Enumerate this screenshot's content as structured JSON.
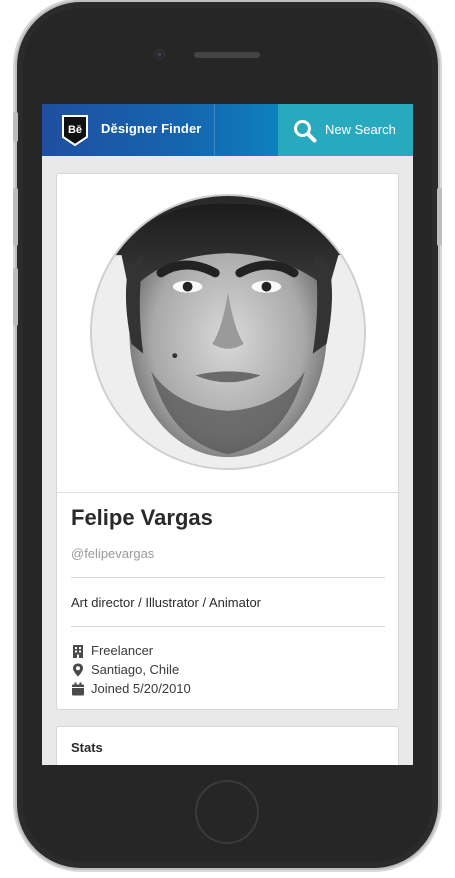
{
  "app": {
    "title": "Dĕsigner Finder",
    "logo_text": "Bē",
    "search_button_label": "New Search"
  },
  "profile": {
    "name": "Felipe Vargas",
    "handle": "@felipevargas",
    "role": "Art director / Illustrator / Animator",
    "company": "Freelancer",
    "location": "Santiago, Chile",
    "joined": "Joined 5/20/2010"
  },
  "stats": {
    "title": "Stats"
  },
  "colors": {
    "header_start": "#1f4fa0",
    "header_end": "#1fb0c6",
    "search_bg": "#29a9bd"
  },
  "icons": {
    "logo": "behance-shield-icon",
    "search": "search-icon",
    "company": "building-icon",
    "location": "map-pin-icon",
    "joined": "calendar-icon"
  }
}
